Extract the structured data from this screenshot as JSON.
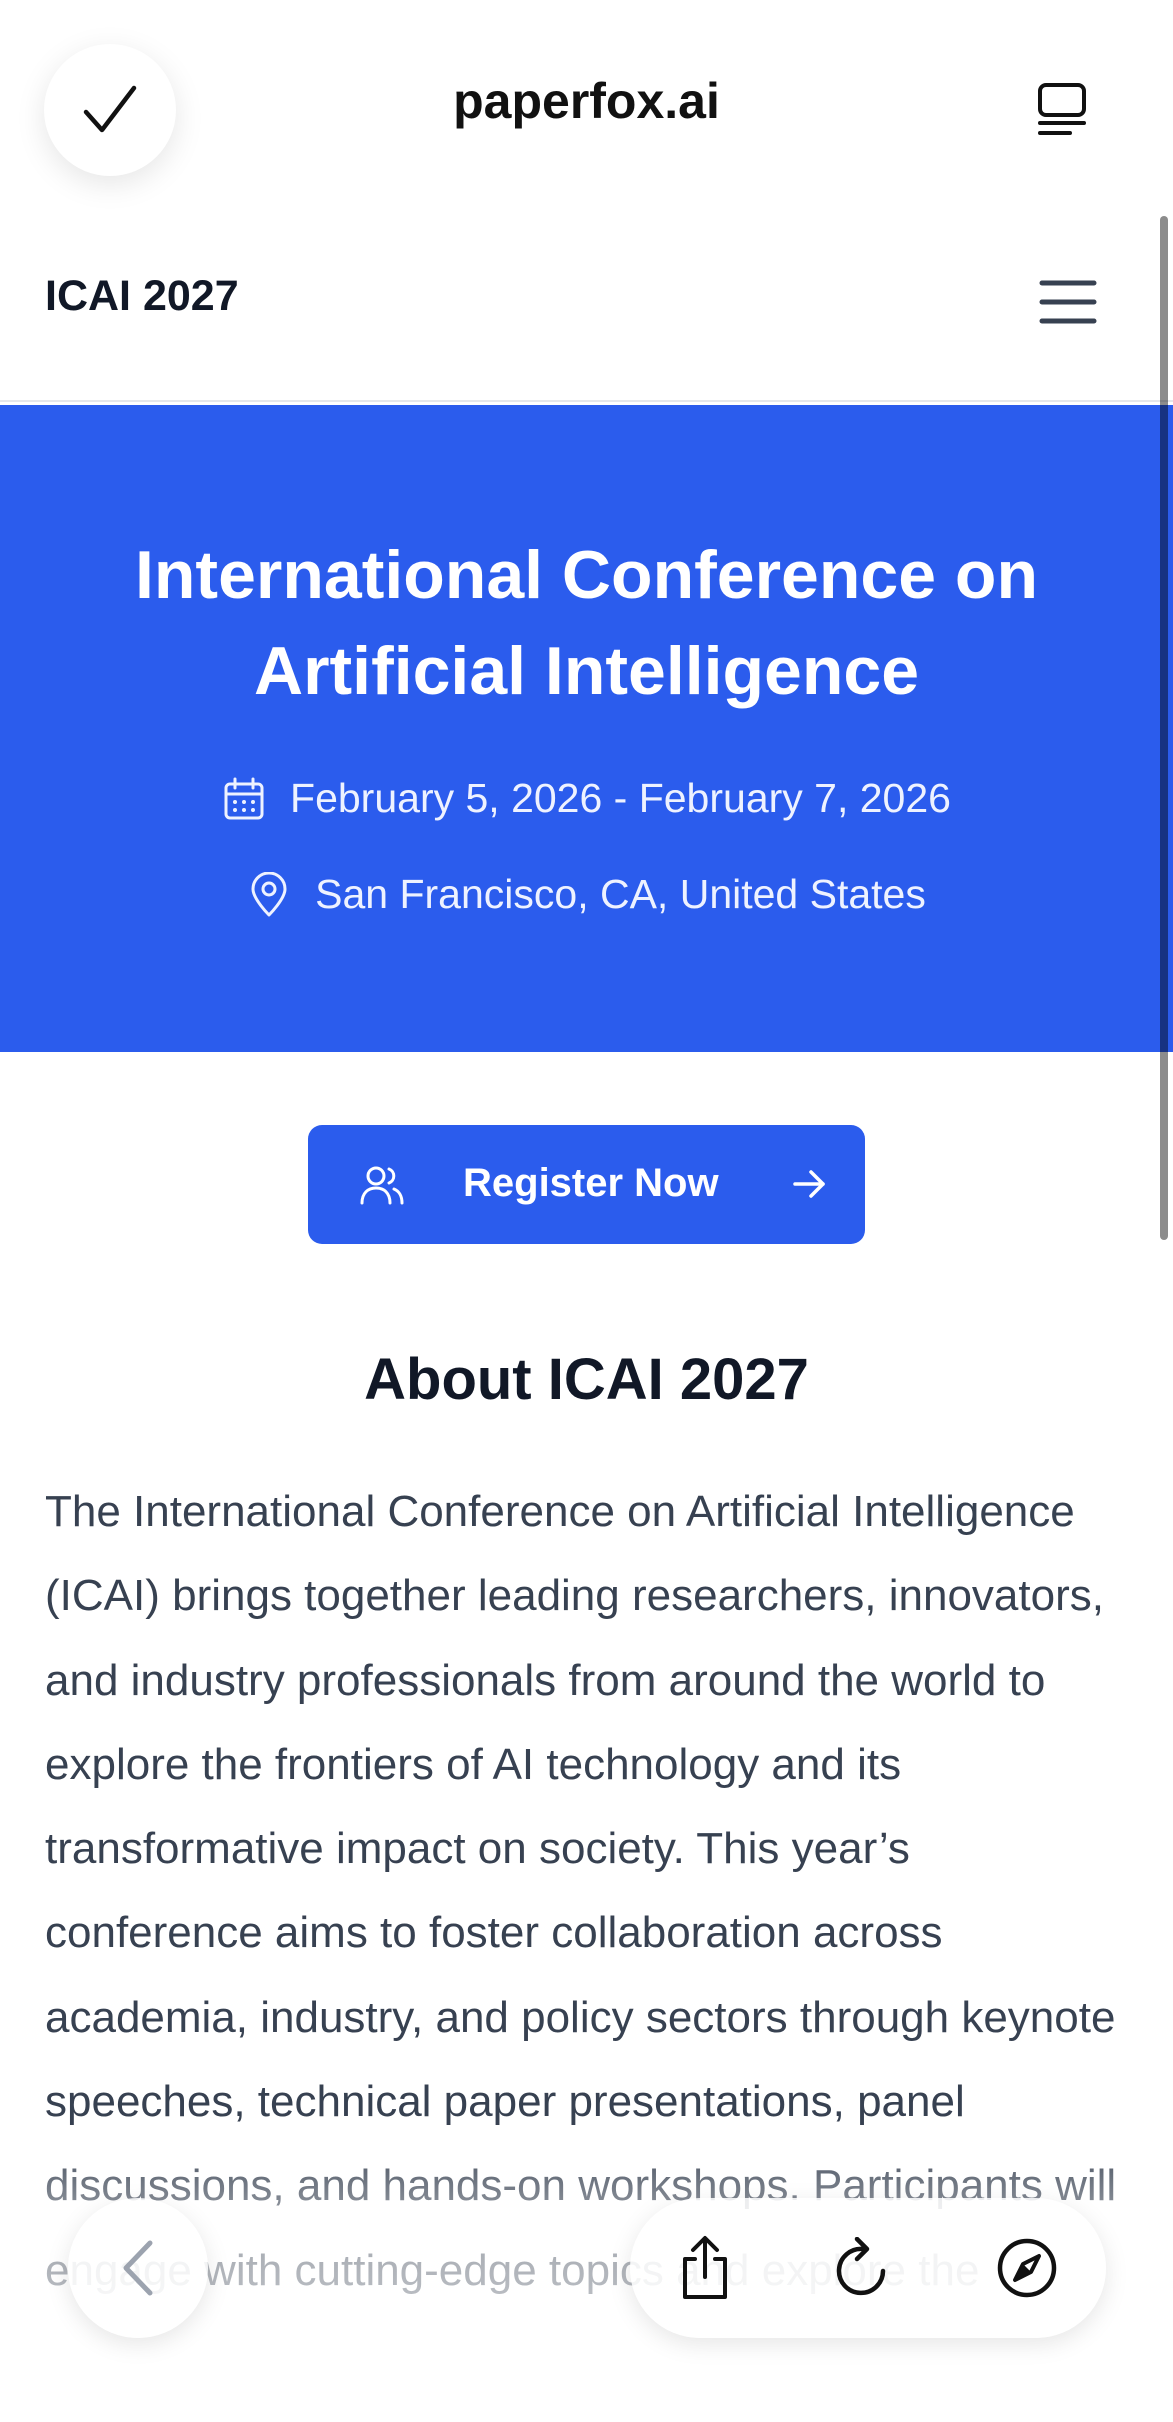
{
  "browser": {
    "url": "paperfox.ai"
  },
  "site": {
    "logo": "ICAI 2027"
  },
  "hero": {
    "title": "International Conference on Artificial Intelligence",
    "dates": "February 5, 2026 - February 7, 2026",
    "location": "San Francisco, CA, United States"
  },
  "register": {
    "label": "Register Now"
  },
  "about": {
    "title": "About ICAI 2027",
    "text": "The International Conference on Artificial Intelligence (ICAI) brings together leading researchers, innovators, and industry professionals from around the world to explore the frontiers of AI technology and its transformative impact on society. This year’s conference aims to foster collaboration across academia, industry, and policy sectors through keynote speeches, technical paper presentations, panel discussions, and hands-on workshops. Participants will engage with cutting-edge topics and explore the"
  },
  "colors": {
    "brand": "#2b5ced",
    "text_dark": "#111827",
    "text_body": "#374151"
  },
  "icons": {
    "done": "checkmark-icon",
    "tabs": "tabs-icon",
    "menu": "hamburger-icon",
    "date": "calendar-icon",
    "location": "map-pin-icon",
    "register": "users-icon",
    "register_arrow": "arrow-right-icon",
    "back": "chevron-left-icon",
    "share": "share-icon",
    "reload": "reload-icon",
    "compass": "compass-icon"
  }
}
